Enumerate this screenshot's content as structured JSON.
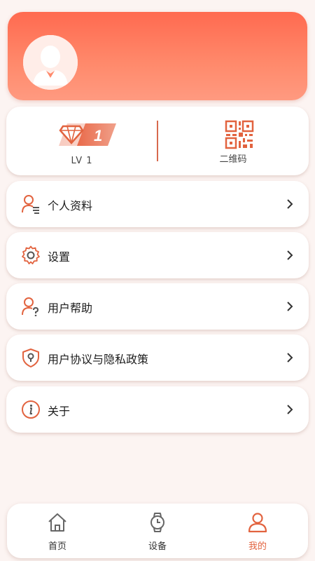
{
  "header": {
    "avatar_icon": "user-avatar-icon",
    "gradient_start": "#ff6a50",
    "gradient_end": "#ff9a80"
  },
  "stats": {
    "level": {
      "badge_number": "1",
      "label": "LV 1",
      "icon": "diamond-badge-icon"
    },
    "qr": {
      "label": "二维码",
      "icon": "qr-code-icon"
    }
  },
  "menu": {
    "items": [
      {
        "label": "个人资料",
        "icon": "profile-icon"
      },
      {
        "label": "设置",
        "icon": "settings-gear-icon"
      },
      {
        "label": "用户帮助",
        "icon": "user-help-icon"
      },
      {
        "label": "用户协议与隐私政策",
        "icon": "shield-lock-icon"
      },
      {
        "label": "关于",
        "icon": "info-icon"
      }
    ]
  },
  "tabbar": {
    "tabs": [
      {
        "label": "首页",
        "icon": "home-icon",
        "active": false
      },
      {
        "label": "设备",
        "icon": "watch-icon",
        "active": false
      },
      {
        "label": "我的",
        "icon": "person-icon",
        "active": true
      }
    ]
  },
  "colors": {
    "accent": "#e2633f",
    "background": "#fcf4f2"
  }
}
